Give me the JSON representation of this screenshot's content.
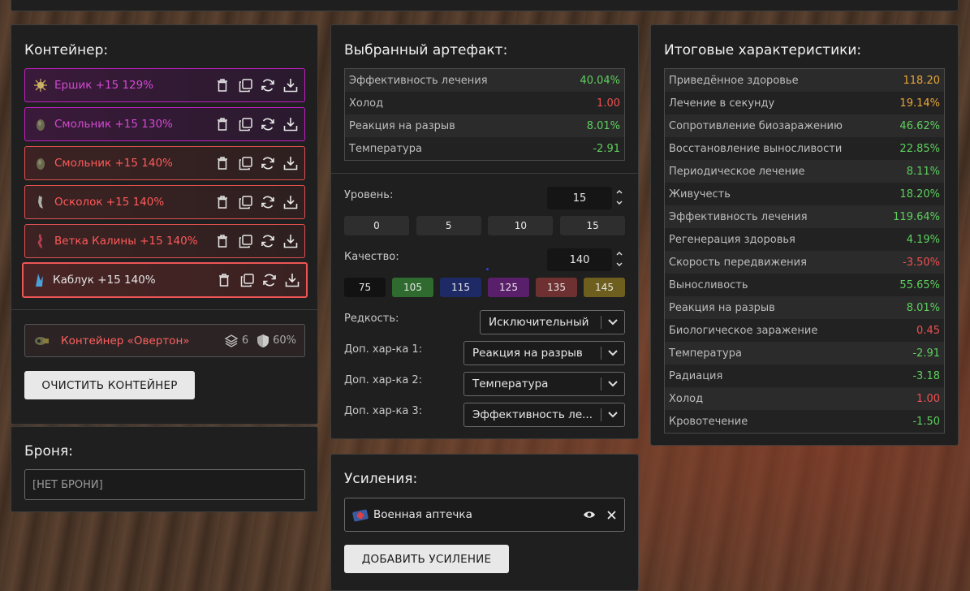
{
  "container": {
    "title": "Контейнер:",
    "artifacts": [
      {
        "name": "Ершик +15 129%",
        "style": "purple"
      },
      {
        "name": "Смольник +15 130%",
        "style": "purple"
      },
      {
        "name": "Смольник +15 140%",
        "style": "red"
      },
      {
        "name": "Осколок +15 140%",
        "style": "red"
      },
      {
        "name": "Ветка Калины +15 140%",
        "style": "red"
      },
      {
        "name": "Каблук +15 140%",
        "style": "selected"
      }
    ],
    "container_item": {
      "name": "Контейнер «Овертон»",
      "slots": "6",
      "protection": "60%"
    },
    "clear_button": "ОЧИСТИТЬ КОНТЕЙНЕР"
  },
  "armor": {
    "title": "Броня:",
    "value": "[НЕТ БРОНИ]"
  },
  "selected_artifact": {
    "title": "Выбранный артефакт:",
    "stats": [
      {
        "label": "Эффективность лечения",
        "value": "40.04%",
        "color": "green"
      },
      {
        "label": "Холод",
        "value": "1.00",
        "color": "red"
      },
      {
        "label": "Реакция на разрыв",
        "value": "8.01%",
        "color": "green"
      },
      {
        "label": "Температура",
        "value": "-2.91",
        "color": "green"
      }
    ],
    "level_label": "Уровень:",
    "level_value": "15",
    "level_presets": [
      "0",
      "5",
      "10",
      "15"
    ],
    "quality_label": "Качество:",
    "quality_value": "140",
    "quality_presets": [
      {
        "label": "75",
        "color": "#121212"
      },
      {
        "label": "105",
        "color": "#2f6a2f"
      },
      {
        "label": "115",
        "color": "#1e2a66"
      },
      {
        "label": "125",
        "color": "#5a1f6a"
      },
      {
        "label": "135",
        "color": "#6e3030"
      },
      {
        "label": "145",
        "color": "#6e5f1e"
      }
    ],
    "rarity_label": "Редкость:",
    "rarity_value": "Исключительный",
    "extra1_label": "Доп. хар-ка 1:",
    "extra1_value": "Реакция на разрыв",
    "extra2_label": "Доп. хар-ка 2:",
    "extra2_value": "Температура",
    "extra3_label": "Доп. хар-ка 3:",
    "extra3_value": "Эффективность ле..."
  },
  "boosts": {
    "title": "Усиления:",
    "items": [
      {
        "name": "Военная аптечка"
      }
    ],
    "add_button": "ДОБАВИТЬ УСИЛЕНИЕ"
  },
  "totals": {
    "title": "Итоговые характеристики:",
    "stats": [
      {
        "label": "Приведённое здоровье",
        "value": "118.20",
        "color": "gold"
      },
      {
        "label": "Лечение в секунду",
        "value": "19.14%",
        "color": "gold"
      },
      {
        "label": "Сопротивление биозаражению",
        "value": "46.62%",
        "color": "green"
      },
      {
        "label": "Восстановление выносливости",
        "value": "22.85%",
        "color": "green"
      },
      {
        "label": "Периодическое лечение",
        "value": "8.11%",
        "color": "green"
      },
      {
        "label": "Живучесть",
        "value": "18.20%",
        "color": "green"
      },
      {
        "label": "Эффективность лечения",
        "value": "119.64%",
        "color": "green"
      },
      {
        "label": "Регенерация здоровья",
        "value": "4.19%",
        "color": "green"
      },
      {
        "label": "Скорость передвижения",
        "value": "-3.50%",
        "color": "red"
      },
      {
        "label": "Выносливость",
        "value": "55.65%",
        "color": "green"
      },
      {
        "label": "Реакция на разрыв",
        "value": "8.01%",
        "color": "green"
      },
      {
        "label": "Биологическое заражение",
        "value": "0.45",
        "color": "red"
      },
      {
        "label": "Температура",
        "value": "-2.91",
        "color": "green"
      },
      {
        "label": "Радиация",
        "value": "-3.18",
        "color": "green"
      },
      {
        "label": "Холод",
        "value": "1.00",
        "color": "red"
      },
      {
        "label": "Кровотечение",
        "value": "-1.50",
        "color": "green"
      }
    ]
  }
}
